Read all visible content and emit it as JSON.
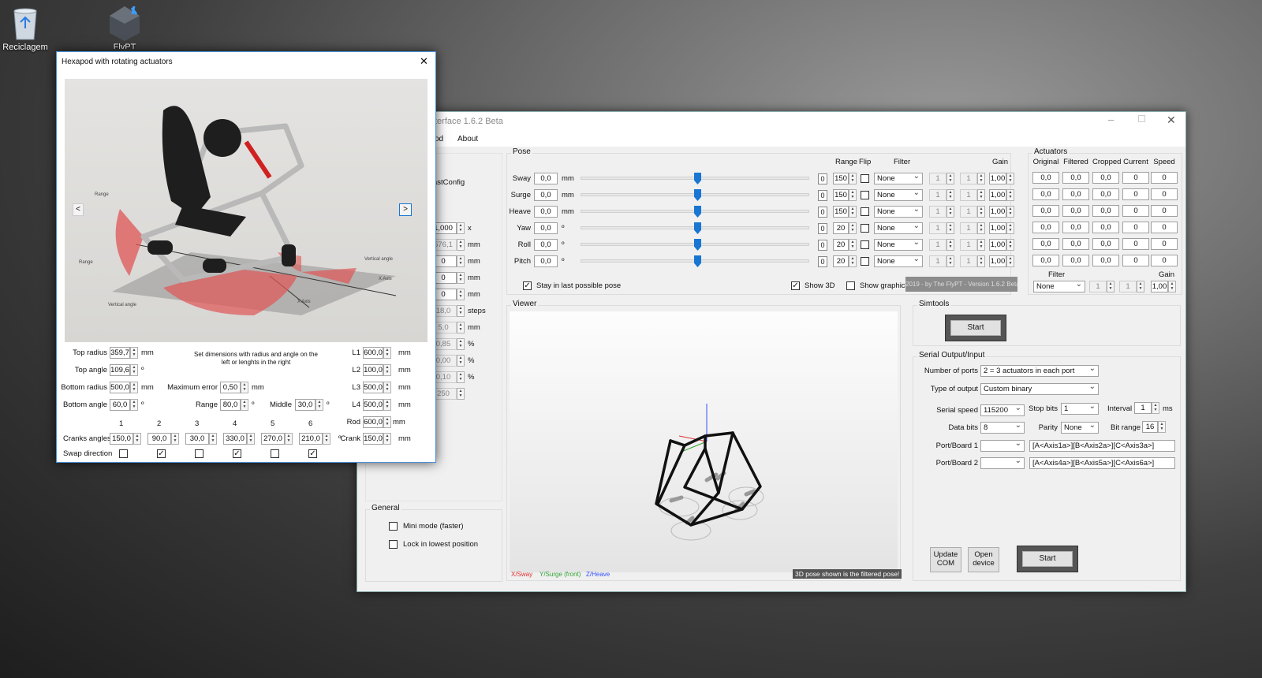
{
  "desktop": {
    "recycle_label": "Reciclagem",
    "flypt_label": "FlyPT"
  },
  "main": {
    "title": "terface 1.6.2 Beta",
    "menu": [
      "od",
      "About"
    ],
    "left_fragment": {
      "config": "astConfig",
      "values": [
        "1,000",
        "576,1",
        "0",
        "0",
        "0",
        "18,0",
        "5,0",
        "0,85",
        "0,00",
        "0,10",
        "250"
      ],
      "units": [
        "x",
        "mm",
        "mm",
        "mm",
        "mm",
        "steps",
        "mm",
        "%",
        "%",
        "%",
        ""
      ]
    },
    "pose": {
      "title": "Pose",
      "range_h": "Range",
      "flip_h": "Flip",
      "filter_h": "Filter",
      "gain_h": "Gain",
      "rows": [
        {
          "name": "Sway",
          "value": "0,0",
          "unit": "mm",
          "zero": "0",
          "range": "150",
          "filter": "None",
          "f1": "1",
          "f2": "1",
          "gain": "1,00"
        },
        {
          "name": "Surge",
          "value": "0,0",
          "unit": "mm",
          "zero": "0",
          "range": "150",
          "filter": "None",
          "f1": "1",
          "f2": "1",
          "gain": "1,00"
        },
        {
          "name": "Heave",
          "value": "0,0",
          "unit": "mm",
          "zero": "0",
          "range": "150",
          "filter": "None",
          "f1": "1",
          "f2": "1",
          "gain": "1,00"
        },
        {
          "name": "Yaw",
          "value": "0,0",
          "unit": "º",
          "zero": "0",
          "range": "20",
          "filter": "None",
          "f1": "1",
          "f2": "1",
          "gain": "1,00"
        },
        {
          "name": "Roll",
          "value": "0,0",
          "unit": "º",
          "zero": "0",
          "range": "20",
          "filter": "None",
          "f1": "1",
          "f2": "1",
          "gain": "1,00"
        },
        {
          "name": "Pitch",
          "value": "0,0",
          "unit": "º",
          "zero": "0",
          "range": "20",
          "filter": "None",
          "f1": "1",
          "f2": "1",
          "gain": "1,00"
        }
      ],
      "stay_label": "Stay in last possible pose",
      "show3d_label": "Show 3D",
      "showgraphic_label": "Show graphic",
      "version_text": "2019 - by The FlyPT - Version 1.6.2 Beta"
    },
    "actuators": {
      "title": "Actuators",
      "headers": [
        "Original",
        "Filtered",
        "Cropped",
        "Current",
        "Speed"
      ],
      "rows": [
        [
          "0,0",
          "0,0",
          "0,0",
          "0",
          "0"
        ],
        [
          "0,0",
          "0,0",
          "0,0",
          "0",
          "0"
        ],
        [
          "0,0",
          "0,0",
          "0,0",
          "0",
          "0"
        ],
        [
          "0,0",
          "0,0",
          "0,0",
          "0",
          "0"
        ],
        [
          "0,0",
          "0,0",
          "0,0",
          "0",
          "0"
        ],
        [
          "0,0",
          "0,0",
          "0,0",
          "0",
          "0"
        ]
      ],
      "filter_label": "Filter",
      "gain_label": "Gain",
      "filter_value": "None",
      "f1": "1",
      "f2": "1",
      "gain_value": "1,00"
    },
    "viewer": {
      "title": "Viewer",
      "x_label": "X/Sway",
      "y_label": "Y/Surge (front)",
      "z_label": "Z/Heave",
      "note": "3D pose shown is the filtered pose!"
    },
    "simtools": {
      "title": "Simtools",
      "start": "Start"
    },
    "serial": {
      "title": "Serial Output/Input",
      "ports_label": "Number of ports",
      "ports_value": "2 = 3 actuators in each port",
      "output_label": "Type of output",
      "output_value": "Custom binary",
      "speed_label": "Serial speed",
      "speed_value": "115200",
      "stopbits_label": "Stop bits",
      "stopbits_value": "1",
      "interval_label": "Interval",
      "interval_value": "1",
      "interval_unit": "ms",
      "databits_label": "Data bits",
      "databits_value": "8",
      "parity_label": "Parity",
      "parity_value": "None",
      "bitrange_label": "Bit range",
      "bitrange_value": "16",
      "port1_label": "Port/Board 1",
      "port1_string": "[A<Axis1a>][B<Axis2a>][C<Axis3a>]",
      "port2_label": "Port/Board 2",
      "port2_string": "[A<Axis4a>][B<Axis5a>][C<Axis6a>]",
      "update_com": "Update COM",
      "open_device": "Open device",
      "start": "Start"
    },
    "general": {
      "title": "General",
      "mini_mode": "Mini mode (faster)",
      "lock_lowest": "Lock in lowest position"
    }
  },
  "hexapod": {
    "title": "Hexapod with rotating actuators",
    "image_labels": {
      "range": "Range",
      "vertical_angle": "Vertical angle",
      "x_axis": "X Axis"
    },
    "top_radius_label": "Top radius",
    "top_radius": "359,7",
    "top_radius_unit": "mm",
    "top_angle_label": "Top angle",
    "top_angle": "109,6",
    "top_angle_unit": "º",
    "bottom_radius_label": "Bottom radius",
    "bottom_radius": "500,0",
    "bottom_radius_unit": "mm",
    "bottom_angle_label": "Bottom angle",
    "bottom_angle": "60,0",
    "bottom_angle_unit": "º",
    "hint": "Set dimensions with radius and angle on the left or lenghts in the right",
    "max_error_label": "Maximum error",
    "max_error": "0,50",
    "max_error_unit": "mm",
    "range_label": "Range",
    "range": "80,0",
    "range_unit": "º",
    "middle_label": "Middle",
    "middle": "30,0",
    "middle_unit": "º",
    "lengths": [
      {
        "label": "L1",
        "value": "600,0",
        "unit": "mm"
      },
      {
        "label": "L2",
        "value": "100,0",
        "unit": "mm"
      },
      {
        "label": "L3",
        "value": "500,0",
        "unit": "mm"
      },
      {
        "label": "L4",
        "value": "500,0",
        "unit": "mm"
      }
    ],
    "rod_label": "Rod",
    "rod": "600,0",
    "rod_unit": "mm",
    "crank_label": "Crank",
    "crank": "150,0",
    "crank_unit": "mm",
    "crank_numbers": [
      "1",
      "2",
      "3",
      "4",
      "5",
      "6"
    ],
    "cranks_angles_label": "Cranks angles",
    "cranks_angles": [
      "150,0",
      "90,0",
      "30,0",
      "330,0",
      "270,0",
      "210,0"
    ],
    "cranks_unit": "º",
    "swap_label": "Swap direction",
    "swap_checked": [
      false,
      true,
      false,
      true,
      false,
      true
    ]
  }
}
